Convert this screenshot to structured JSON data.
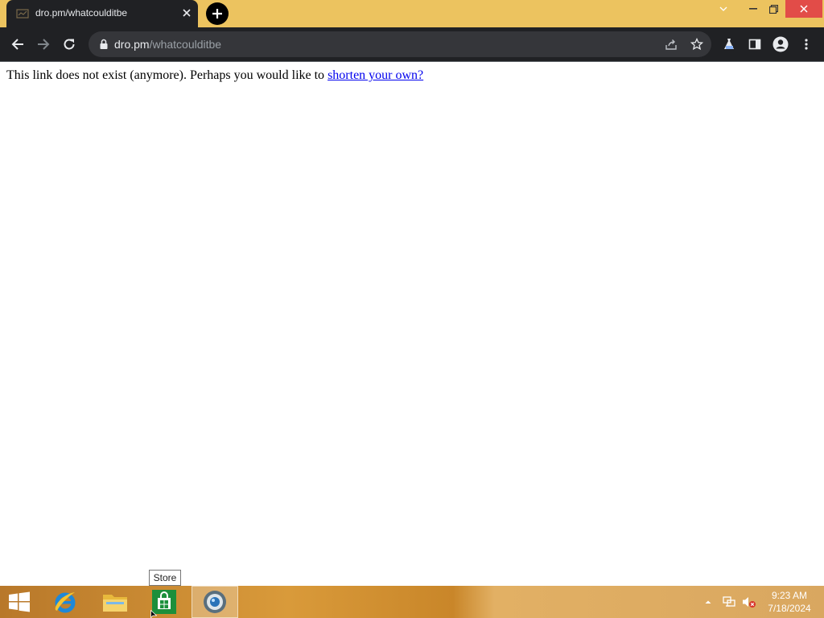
{
  "browser": {
    "tab": {
      "title": "dro.pm/whatcoulditbe"
    },
    "address": {
      "host": "dro.pm",
      "path": "/whatcoulditbe"
    }
  },
  "page": {
    "message": "This link does not exist (anymore). Perhaps you would like to ",
    "link_text": "shorten your own?"
  },
  "taskbar": {
    "tooltip": "Store",
    "items": [
      "start-button",
      "internet-explorer",
      "file-explorer",
      "store",
      "browser"
    ],
    "clock": {
      "time": "9:23 AM",
      "date": "7/18/2024"
    }
  },
  "colors": {
    "titlebar": "#ecc35f",
    "toolbar": "#202124",
    "omnibox": "#35363a",
    "link": "#0000ee",
    "close": "#e24c48"
  }
}
